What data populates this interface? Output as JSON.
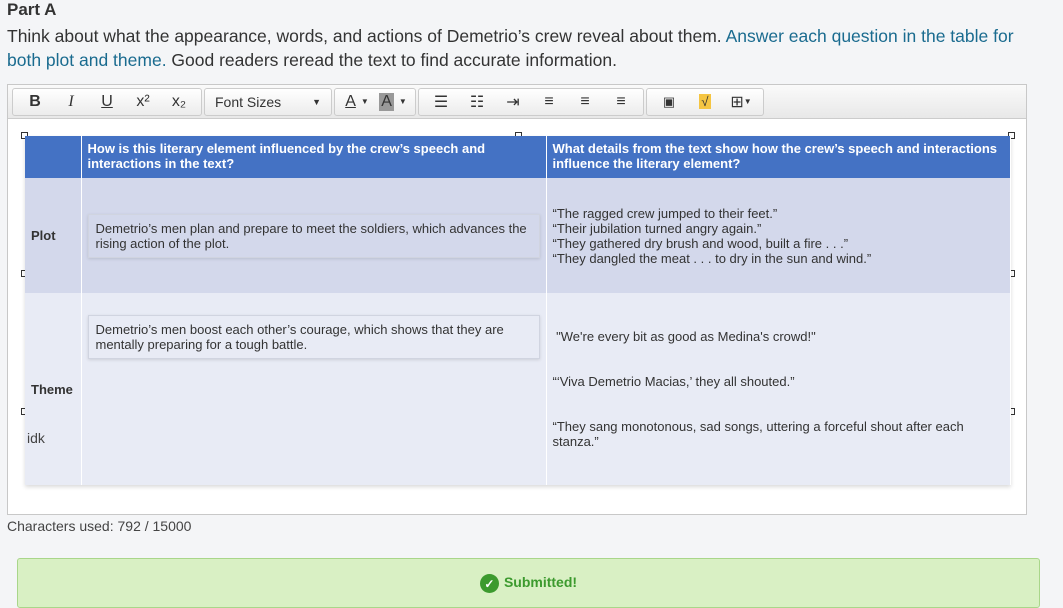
{
  "heading": "Part A",
  "instructions": {
    "pre": "Think about what the appearance, words, and actions of Demetrio’s crew reveal about them. ",
    "highlight": "Answer each question in the table for both plot and theme.",
    "post": " Good readers reread the text to find accurate information."
  },
  "toolbar": {
    "bold": "B",
    "italic": "I",
    "underline": "U",
    "superscript": "x²",
    "subscript": "x₂",
    "font_sizes": "Font Sizes",
    "font_color": "A",
    "bg_color": "A"
  },
  "table": {
    "headers": [
      "",
      "How is this literary element influenced by the crew’s speech and interactions in the text?",
      "What details from the text show how the crew’s speech and interactions influence the literary element?"
    ],
    "rows": [
      {
        "label": "Plot",
        "answer": "Demetrio’s men plan and prepare to meet the soldiers, which advances the rising action of the plot.",
        "details": [
          "“The ragged crew jumped to their feet.”",
          "“Their jubilation turned angry again.”",
          "“They gathered dry brush and wood, built a fire . . .”",
          "“They dangled the meat . . . to dry in the sun and wind.”"
        ]
      },
      {
        "label": "Theme",
        "answer": "Demetrio’s men boost each other’s courage, which shows that they are mentally preparing for a tough battle.",
        "details": [
          " \"We're every bit as good as Medina's crowd!\"",
          "“‘Viva Demetrio Macias,’ they all shouted.”",
          "“They sang monotonous, sad songs, uttering a forceful shout after each stanza.”"
        ]
      }
    ]
  },
  "extra_text": "idk",
  "char_count": "Characters used: 792 / 15000",
  "status": "Submitted!"
}
